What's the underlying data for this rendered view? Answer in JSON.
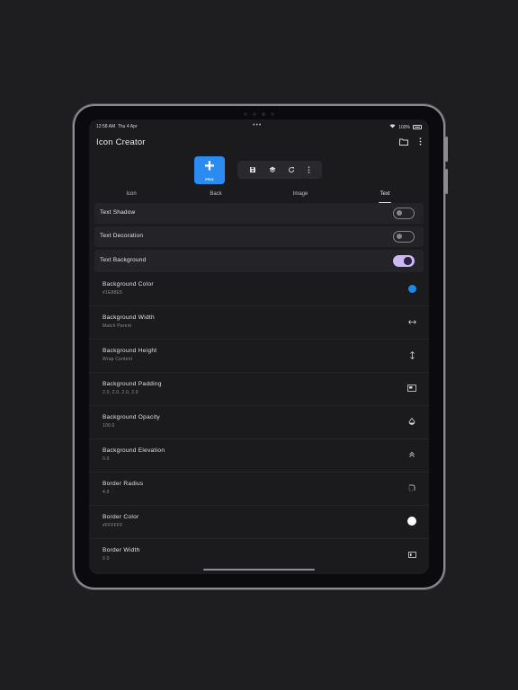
{
  "status": {
    "time": "12:58 AM",
    "date": "Thu 4 Apr",
    "dots": "•••",
    "battery": "100%"
  },
  "app": {
    "title": "Icon Creator"
  },
  "pro_button": {
    "label": "PRO"
  },
  "tabs": [
    {
      "label": "Icon"
    },
    {
      "label": "Back"
    },
    {
      "label": "Image"
    },
    {
      "label": "Text"
    }
  ],
  "active_tab": "Text",
  "toggles": [
    {
      "label": "Text Shadow",
      "on": false
    },
    {
      "label": "Text Decoration",
      "on": false
    },
    {
      "label": "Text Background",
      "on": true
    }
  ],
  "properties": [
    {
      "title": "Background Color",
      "value": "#1E88E5",
      "icon": "color-swatch-icon",
      "color": "#1E88E5"
    },
    {
      "title": "Background Width",
      "value": "Match Parent",
      "icon": "horizontal-arrows-icon"
    },
    {
      "title": "Background Height",
      "value": "Wrap Content",
      "icon": "vertical-arrows-icon"
    },
    {
      "title": "Background Padding",
      "value": "2.0, 2.0, 2.0, 2.0",
      "icon": "padding-icon"
    },
    {
      "title": "Background Opacity",
      "value": "100.0",
      "icon": "opacity-icon"
    },
    {
      "title": "Background Elevation",
      "value": "0.0",
      "icon": "elevation-icon"
    },
    {
      "title": "Border Radius",
      "value": "4.0",
      "icon": "rounded-corner-icon"
    },
    {
      "title": "Border Color",
      "value": "#FFFFFF",
      "icon": "color-swatch-icon",
      "color": "#FFFFFF"
    },
    {
      "title": "Border Width",
      "value": "0.0",
      "icon": "border-width-icon"
    }
  ],
  "colors": {
    "accent": "#2A8CF0",
    "toggle_on": "#CDB8F5",
    "background": "#1B1B1E"
  }
}
